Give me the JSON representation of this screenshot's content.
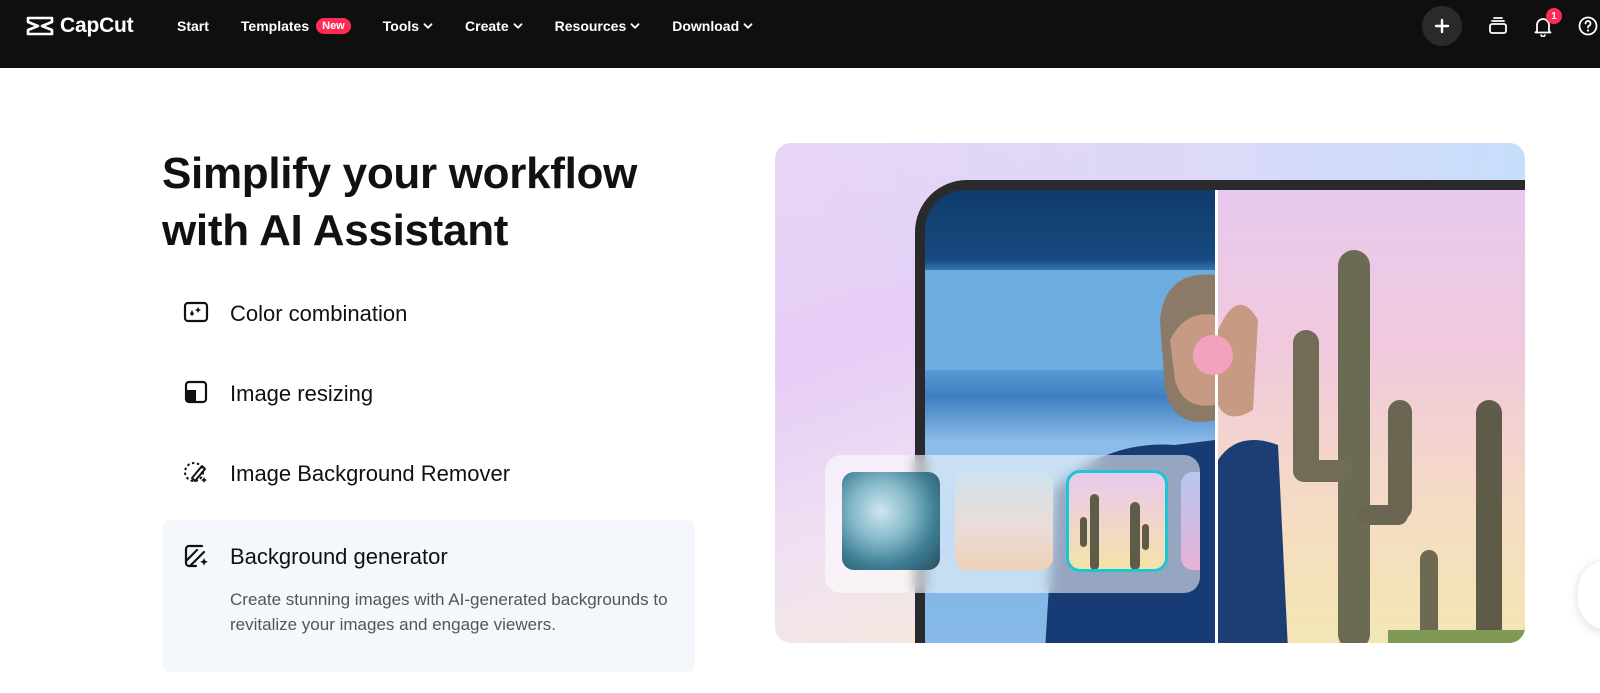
{
  "app": {
    "name": "CapCut"
  },
  "nav": {
    "items": [
      {
        "label": "Start",
        "has_dropdown": false
      },
      {
        "label": "Templates",
        "has_dropdown": false,
        "badge": "New"
      },
      {
        "label": "Tools",
        "has_dropdown": true
      },
      {
        "label": "Create",
        "has_dropdown": true
      },
      {
        "label": "Resources",
        "has_dropdown": true
      },
      {
        "label": "Download",
        "has_dropdown": true
      }
    ]
  },
  "header_actions": {
    "notifications_count": "1",
    "icons": [
      "plus-icon",
      "stack-icon",
      "bell-icon",
      "help-icon"
    ]
  },
  "main": {
    "headline_line1": "Simplify your workflow",
    "headline_line2": "with AI Assistant",
    "features": [
      {
        "label": "Color combination",
        "icon": "color-combination-icon",
        "active": false
      },
      {
        "label": "Image resizing",
        "icon": "resize-icon",
        "active": false
      },
      {
        "label": "Image Background Remover",
        "icon": "background-remover-icon",
        "active": false
      },
      {
        "label": "Background generator",
        "icon": "background-generator-icon",
        "active": true,
        "description": "Create stunning images with AI-generated backgrounds to revitalize your images and engage viewers."
      }
    ]
  },
  "hero": {
    "thumbnails": [
      "ocean-waves",
      "pastel-sky",
      "desert-cactus",
      "pink-gradient"
    ],
    "selected_thumbnail": "desert-cactus"
  },
  "colors": {
    "topbar": "#0f0f10",
    "badge": "#fe2c55",
    "selected_outline": "#1cc7d4",
    "active_feature_bg": "#f4f7fb"
  }
}
